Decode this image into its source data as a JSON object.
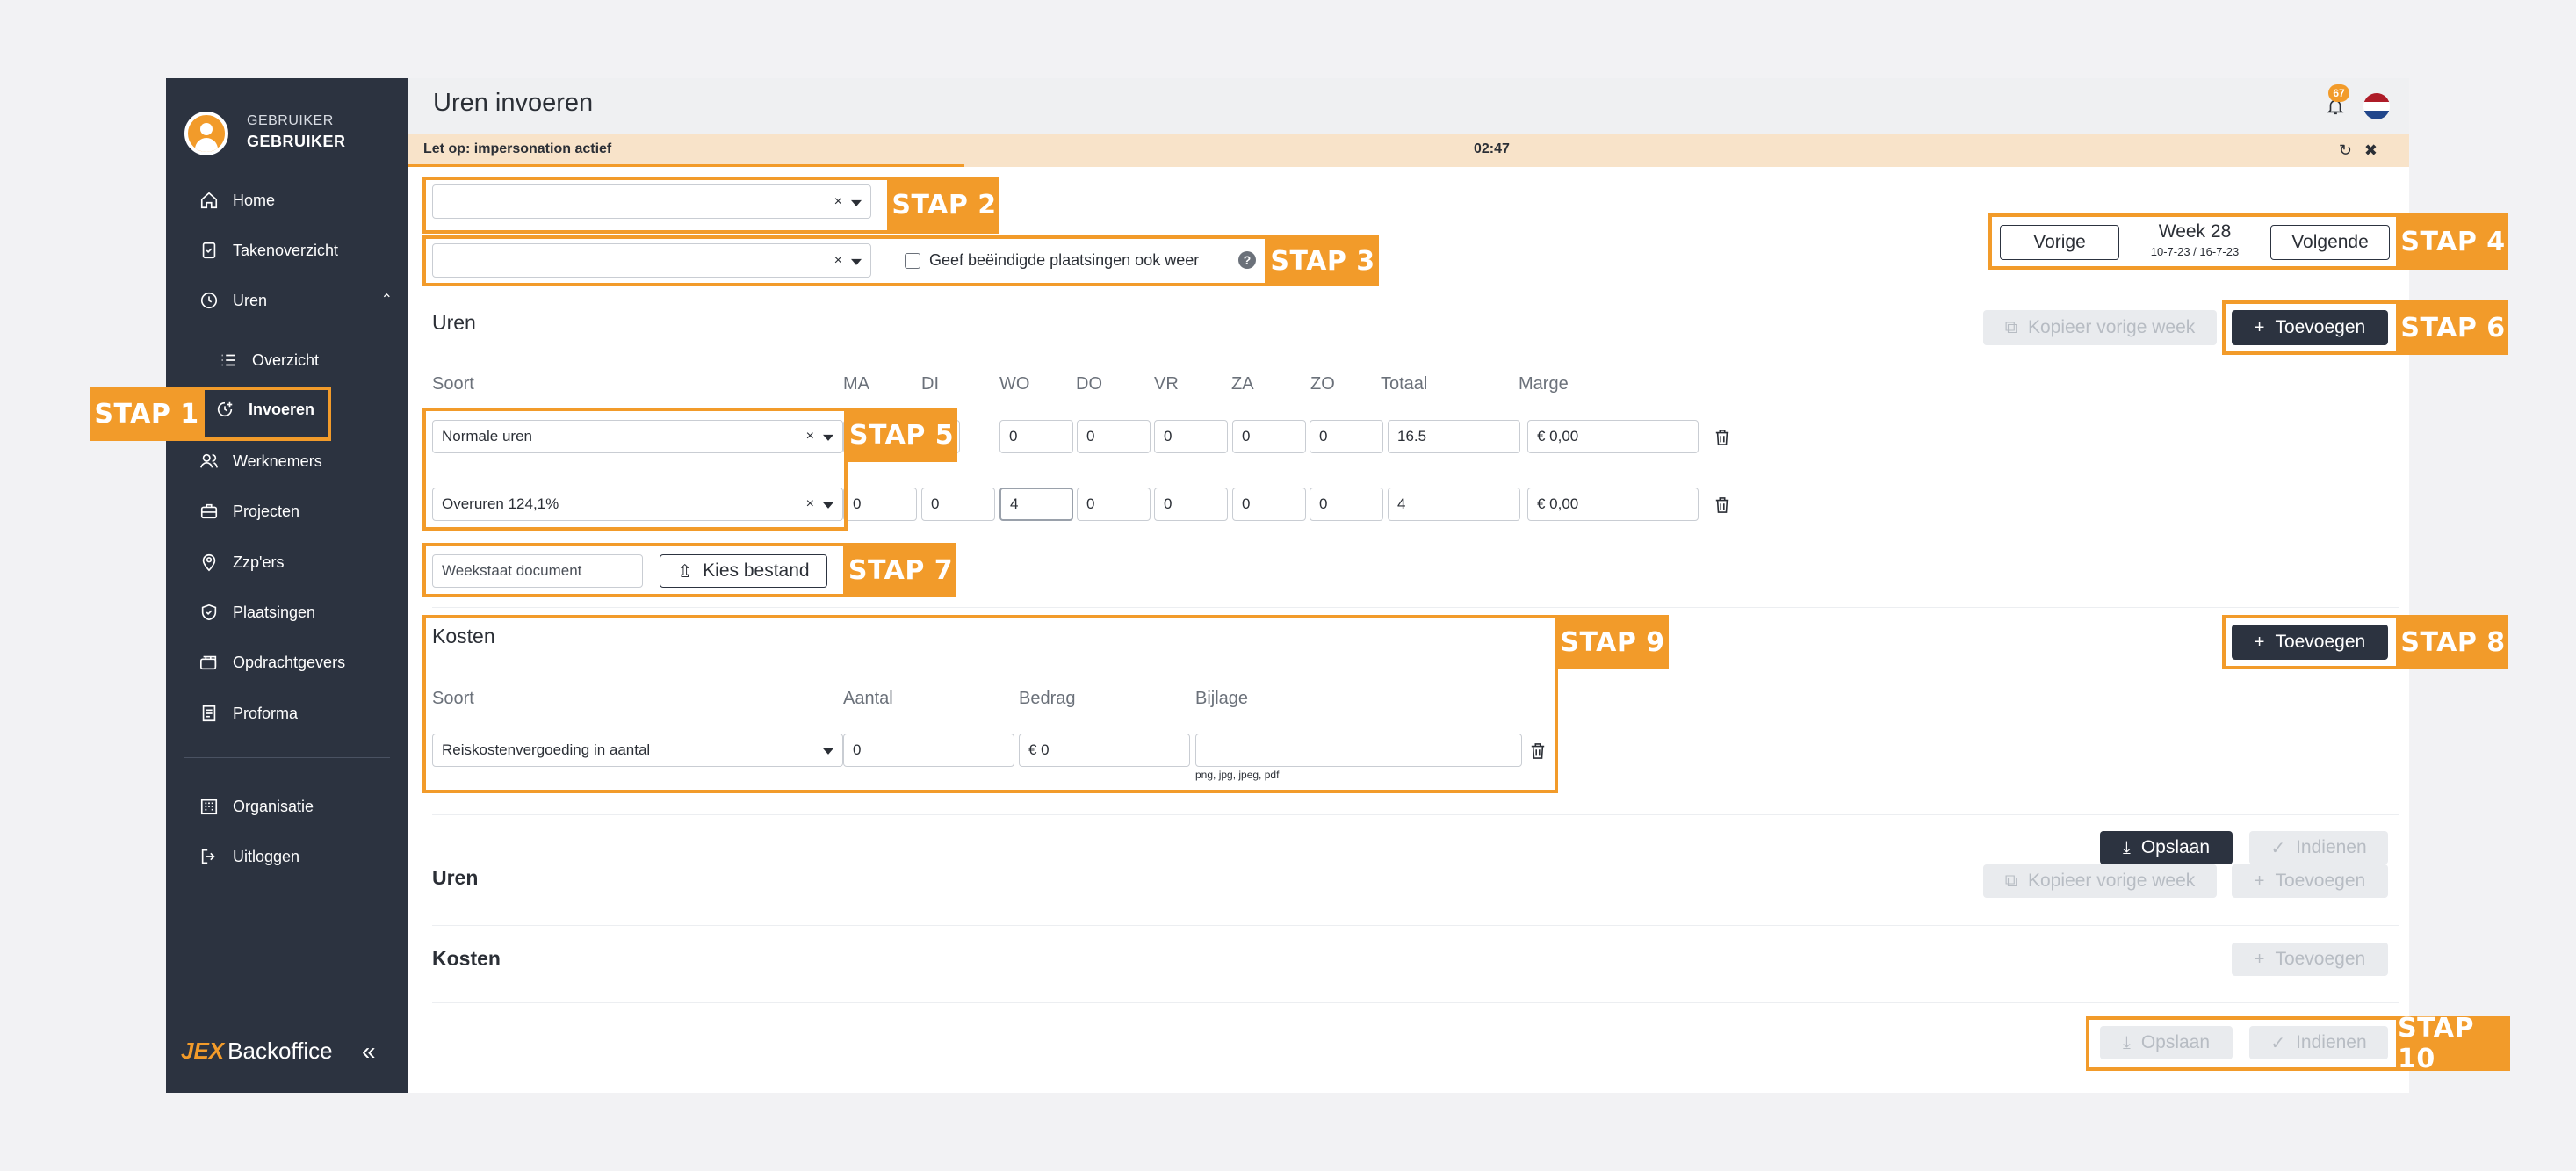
{
  "user": {
    "role": "GEBRUIKER",
    "name": "GEBRUIKER"
  },
  "nav": {
    "home": "Home",
    "takenoverzicht": "Takenoverzicht",
    "uren": "Uren",
    "overzicht": "Overzicht",
    "invoeren": "Invoeren",
    "werknemers": "Werknemers",
    "projecten": "Projecten",
    "zzpers": "Zzp'ers",
    "plaatsingen": "Plaatsingen",
    "opdrachtgevers": "Opdrachtgevers",
    "proforma": "Proforma",
    "organisatie": "Organisatie",
    "uitloggen": "Uitloggen"
  },
  "brand": {
    "jex": "JEX",
    "name": "Backoffice"
  },
  "header": {
    "title": "Uren invoeren",
    "notification_count": "67"
  },
  "impersonation": {
    "text": "Let op: impersonation actief",
    "time": "02:47"
  },
  "filters": {
    "show_ended_label": "Geef beëindigde plaatsingen ook weer",
    "help": "?"
  },
  "week": {
    "prev": "Vorige",
    "next": "Volgende",
    "label": "Week 28",
    "range": "10-7-23 / 16-7-23"
  },
  "uren": {
    "title": "Uren",
    "copy_prev": "Kopieer vorige week",
    "add": "Toevoegen",
    "columns": [
      "Soort",
      "MA",
      "DI",
      "WO",
      "DO",
      "VR",
      "ZA",
      "ZO",
      "Totaal",
      "Marge"
    ],
    "rows": [
      {
        "soort": "Normale uren",
        "days": [
          "",
          "",
          "0",
          "0",
          "0",
          "0",
          "0"
        ],
        "totaal": "16.5",
        "marge": "€ 0,00"
      },
      {
        "soort": "Overuren 124,1%",
        "days": [
          "0",
          "0",
          "4",
          "0",
          "0",
          "0",
          "0"
        ],
        "totaal": "4",
        "marge": "€ 0,00"
      }
    ],
    "weekstaat_placeholder": "Weekstaat document",
    "choose_file": "Kies bestand"
  },
  "kosten": {
    "title": "Kosten",
    "add": "Toevoegen",
    "columns": [
      "Soort",
      "Aantal",
      "Bedrag",
      "Bijlage"
    ],
    "row": {
      "soort": "Reiskostenvergoeding in aantal",
      "aantal": "0",
      "bedrag": "€ 0",
      "bijlage": "",
      "hint": "png, jpg, jpeg, pdf"
    }
  },
  "actions": {
    "save": "Opslaan",
    "submit": "Indienen"
  },
  "second": {
    "uren_title": "Uren",
    "kosten_title": "Kosten",
    "copy_prev": "Kopieer vorige week",
    "add": "Toevoegen",
    "add_kosten": "Toevoegen",
    "save": "Opslaan",
    "submit": "Indienen"
  },
  "steps": [
    "STAP 1",
    "STAP 2",
    "STAP 3",
    "STAP 4",
    "STAP 5",
    "STAP 6",
    "STAP 7",
    "STAP 8",
    "STAP 9",
    "STAP 10"
  ],
  "colors": {
    "accent": "#f29b2a",
    "sidebar": "#2c3340",
    "banner": "#f8e3c9"
  }
}
